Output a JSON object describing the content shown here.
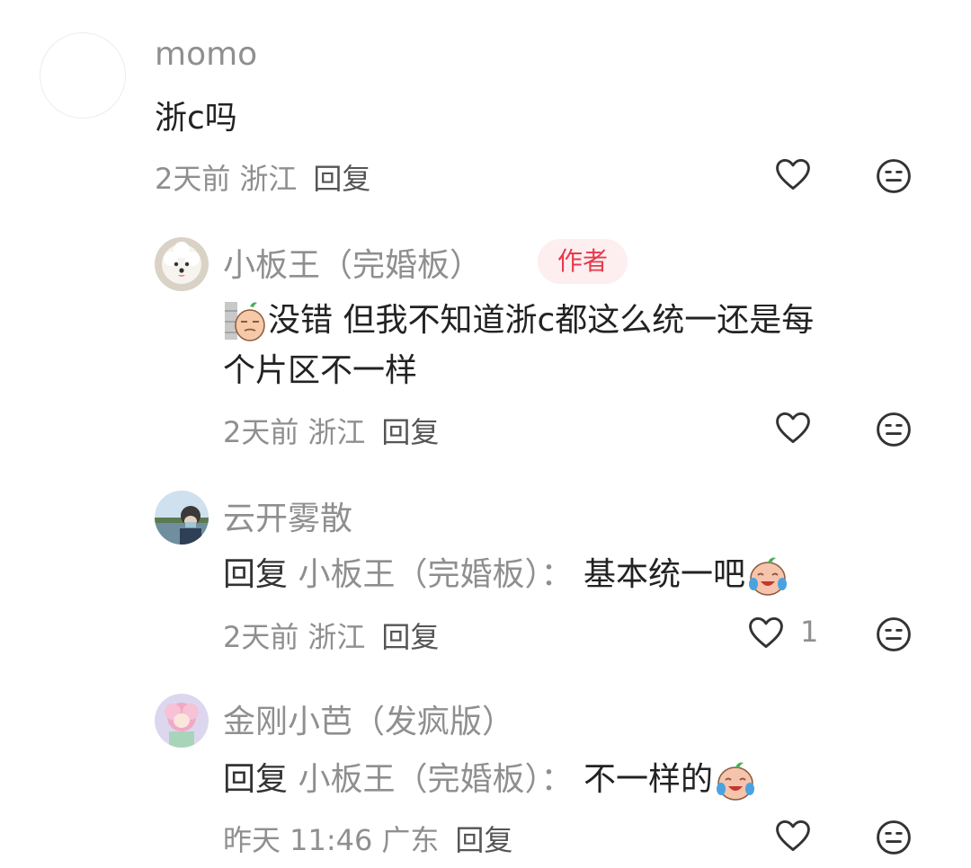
{
  "comments": [
    {
      "user": "momo",
      "text": "浙c吗",
      "time": "2天前",
      "location": "浙江",
      "reply_label": "回复"
    },
    {
      "user": "小板王（完婚板）",
      "badge": "作者",
      "text_line1": "没错 但我不知道浙c都这么统一还是每",
      "text_line2": "个片区不一样",
      "time": "2天前",
      "location": "浙江",
      "reply_label": "回复"
    },
    {
      "user": "云开雾散",
      "reply_prefix": "回复",
      "reply_target": "小板王（完婚板）：",
      "text": "基本统一吧",
      "time": "2天前",
      "location": "浙江",
      "reply_label": "回复",
      "like_count": "1"
    },
    {
      "user": "金刚小芭（发疯版）",
      "reply_prefix": "回复",
      "reply_target": "小板王（完婚板）：",
      "text": "不一样的",
      "time": "昨天 11:46",
      "location": "广东",
      "reply_label": "回复"
    }
  ],
  "icons": {
    "like": "heart-outline-icon",
    "dislike": "neutral-face-icon",
    "emoji": "crying-laugh-emoji"
  },
  "colors": {
    "badge_text": "#e8394b",
    "badge_bg": "#fdeef0",
    "secondary_text": "#8f8f8f"
  }
}
